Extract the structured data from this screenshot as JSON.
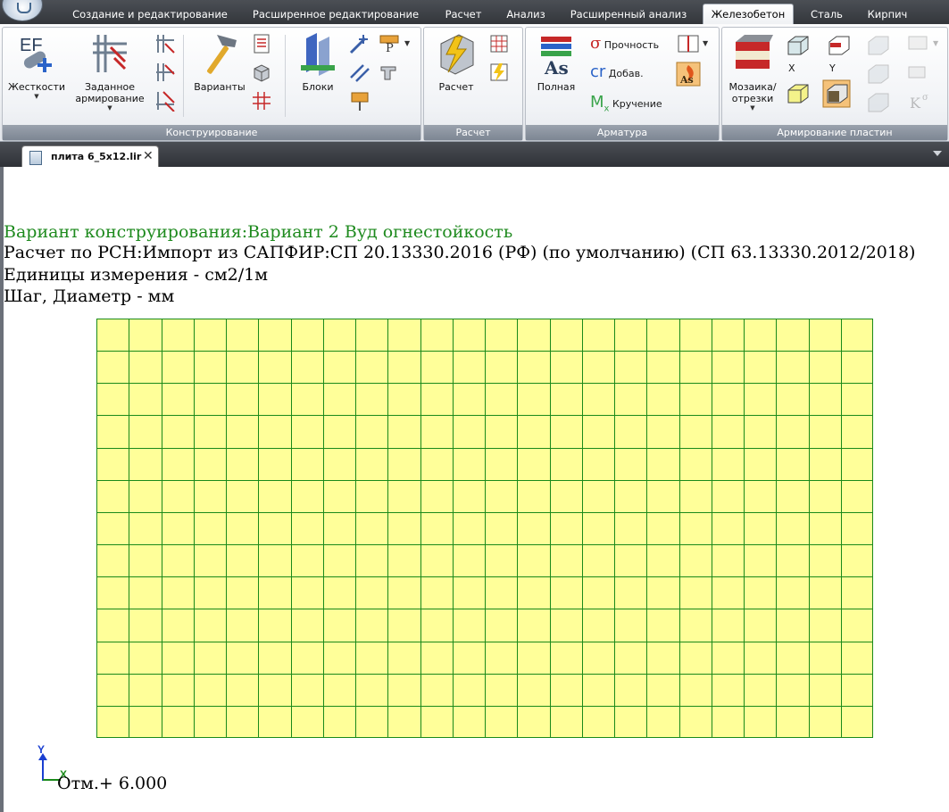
{
  "menu": {
    "tabs": [
      {
        "label": "Создание и редактирование",
        "active": false
      },
      {
        "label": "Расширенное редактирование",
        "active": false
      },
      {
        "label": "Расчет",
        "active": false
      },
      {
        "label": "Анализ",
        "active": false
      },
      {
        "label": "Расширенный анализ",
        "active": false
      },
      {
        "label": "Железобетон",
        "active": true
      },
      {
        "label": "Сталь",
        "active": false
      },
      {
        "label": "Кирпич",
        "active": false
      }
    ]
  },
  "ribbon": {
    "groups": {
      "design": {
        "label": "Конструирование",
        "stiffness": "Жесткости",
        "given_reinforcement": "Заданное армирование",
        "variants": "Варианты",
        "blocks": "Блоки"
      },
      "calc": {
        "label": "Расчет",
        "calc_button": "Расчет"
      },
      "rebar": {
        "label": "Арматура",
        "full": "Полная",
        "strength": "Прочность",
        "additional": "Добав.",
        "torsion": "Кручение"
      },
      "plates": {
        "label": "Армирование пластин",
        "mosaic": "Мозаика/ отрезки",
        "x_label": "X",
        "y_label": "Y"
      }
    }
  },
  "document": {
    "tab_label": "плита 6_5x12.lir",
    "close_glyph": "✕",
    "lines": {
      "variant": "Вариант конструирования:Вариант 2 Вуд огнестойкость",
      "calc": "Расчет по РСН:Импорт из САПФИР:СП 20.13330.2016 (РФ) (по умолчанию) (СП 63.13330.2012/2018)",
      "units": "Единицы измерения - см2/1м",
      "step": "Шаг, Диаметр - мм"
    },
    "mesh": {
      "columns": 24,
      "rows": 13,
      "fill": "#ffff99",
      "stroke": "#1a8a1a"
    },
    "axis": {
      "x": "X",
      "y": "Y"
    },
    "elevation": "Отм.+ 6.000"
  },
  "colors": {
    "accent_green": "#1e8a1e",
    "ribbon_label_bg": "#7d8693",
    "menubar_bg": "#3b3f44"
  }
}
